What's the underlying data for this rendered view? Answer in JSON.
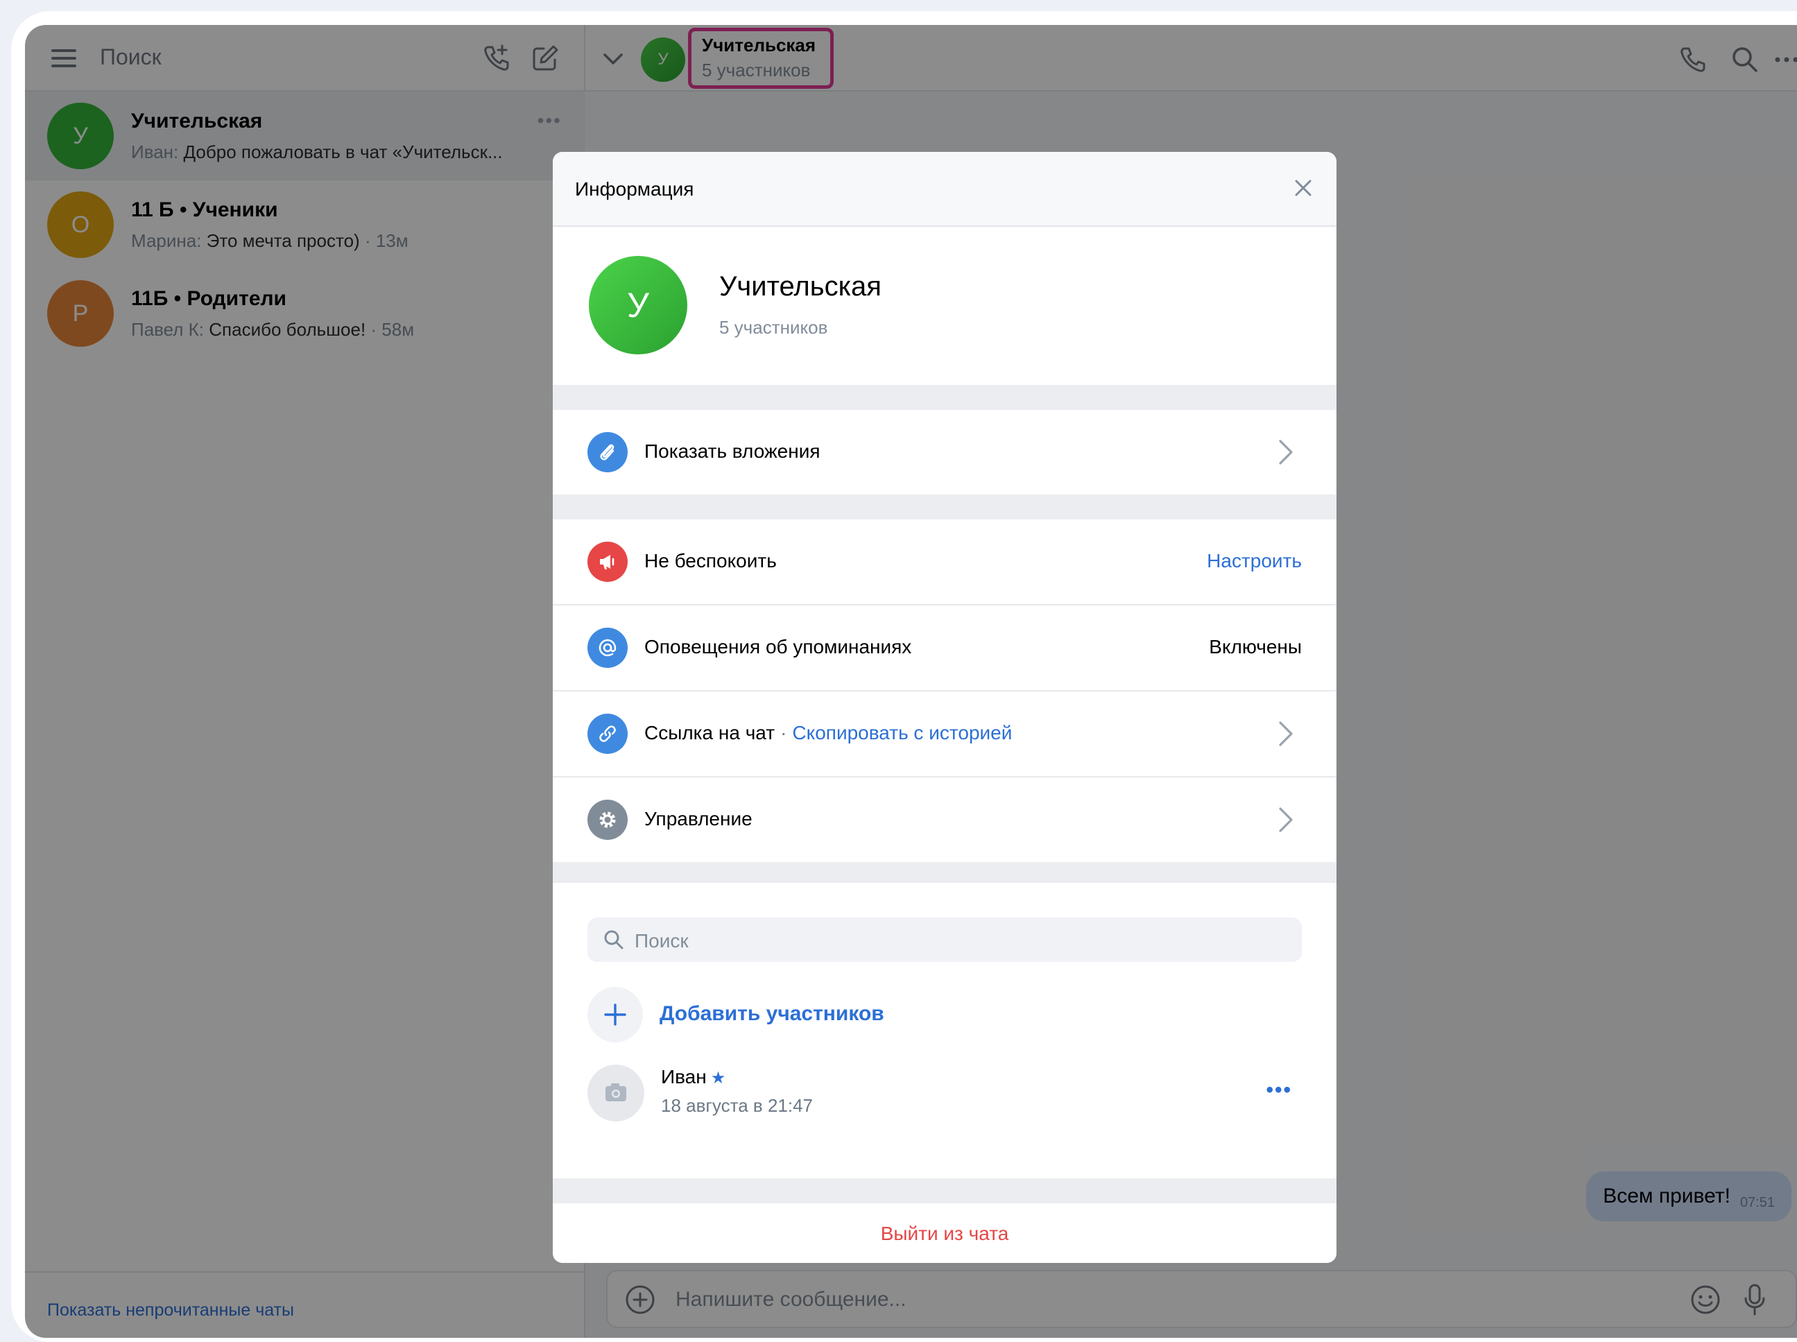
{
  "sidebar": {
    "search_label": "Поиск",
    "chats": [
      {
        "initial": "У",
        "name": "Учительская",
        "sender": "Иван:",
        "text": "Добро пожаловать в чат «Учительск...",
        "time": "",
        "color": "#34b43a"
      },
      {
        "initial": "О",
        "name": "11 Б • Ученики",
        "sender": "Марина:",
        "text": "Это мечта просто)",
        "time": "· 13м",
        "color": "#e2a614"
      },
      {
        "initial": "Р",
        "name": "11Б • Родители",
        "sender": "Павел К:",
        "text": "Спасибо большое!",
        "time": "· 58м",
        "color": "#e8853a"
      }
    ],
    "footer_link": "Показать непрочитанные чаты"
  },
  "header": {
    "avatar_initial": "У",
    "title": "Учительская",
    "subtitle": "5 участников"
  },
  "conversation": {
    "message": "Всем привет!",
    "message_time": "07:51",
    "composer_placeholder": "Напишите сообщение..."
  },
  "modal": {
    "title": "Информация",
    "avatar_initial": "У",
    "chat_name": "Учительская",
    "member_count": "5 участников",
    "attachments_label": "Показать вложения",
    "dnd_label": "Не беспокоить",
    "dnd_action": "Настроить",
    "mentions_label": "Оповещения об упоминаниях",
    "mentions_value": "Включены",
    "link_label": "Ссылка на чат",
    "link_separator": "·",
    "link_action": "Скопировать с историей",
    "manage_label": "Управление",
    "search_placeholder": "Поиск",
    "add_members_label": "Добавить участников",
    "members": [
      {
        "name": "Иван",
        "date": "18 августа в 21:47",
        "is_admin": true
      }
    ],
    "leave_label": "Выйти из чата"
  },
  "colors": {
    "accent": "#2c6fd6",
    "danger": "#e64646",
    "highlight_outline": "#e33b97",
    "attachments_icon": "#3f8ae0",
    "dnd_icon": "#e64646",
    "mentions_icon": "#3f8ae0",
    "link_icon": "#3f8ae0",
    "manage_icon": "#818c99"
  },
  "icons": {
    "menu": "hamburger-icon",
    "call": "phone-icon",
    "search": "search-icon",
    "more": "more-horizontal-icon",
    "close": "close-icon",
    "attachments": "paperclip-icon",
    "dnd": "megaphone-muted-icon",
    "mentions": "at-sign-icon",
    "link": "link-icon",
    "manage": "gear-icon",
    "add": "plus-icon",
    "camera": "camera-icon",
    "emoji": "smile-icon",
    "mic": "microphone-icon"
  }
}
